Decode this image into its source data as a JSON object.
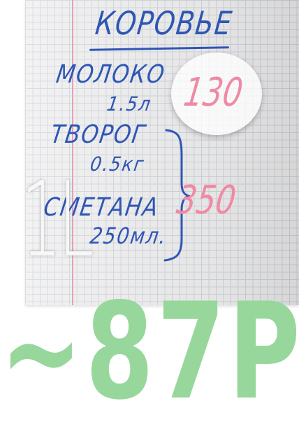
{
  "note": {
    "title": "КОРОВЬЕ",
    "items": [
      {
        "name": "МОЛОКО",
        "amount": "1.5л"
      },
      {
        "name": "ТВОРОГ",
        "amount": "0.5кг"
      },
      {
        "name": "СМЕТАНА",
        "amount": "250мл."
      }
    ],
    "prices": [
      "130",
      "350"
    ]
  },
  "overlay": {
    "volume": "1L",
    "price": "~87Р"
  },
  "colors": {
    "ink": "#2f56b4",
    "price_ink": "#ef8aa4",
    "overlay_price": "#98d79c",
    "overlay_volume": "#f7f7f7"
  }
}
